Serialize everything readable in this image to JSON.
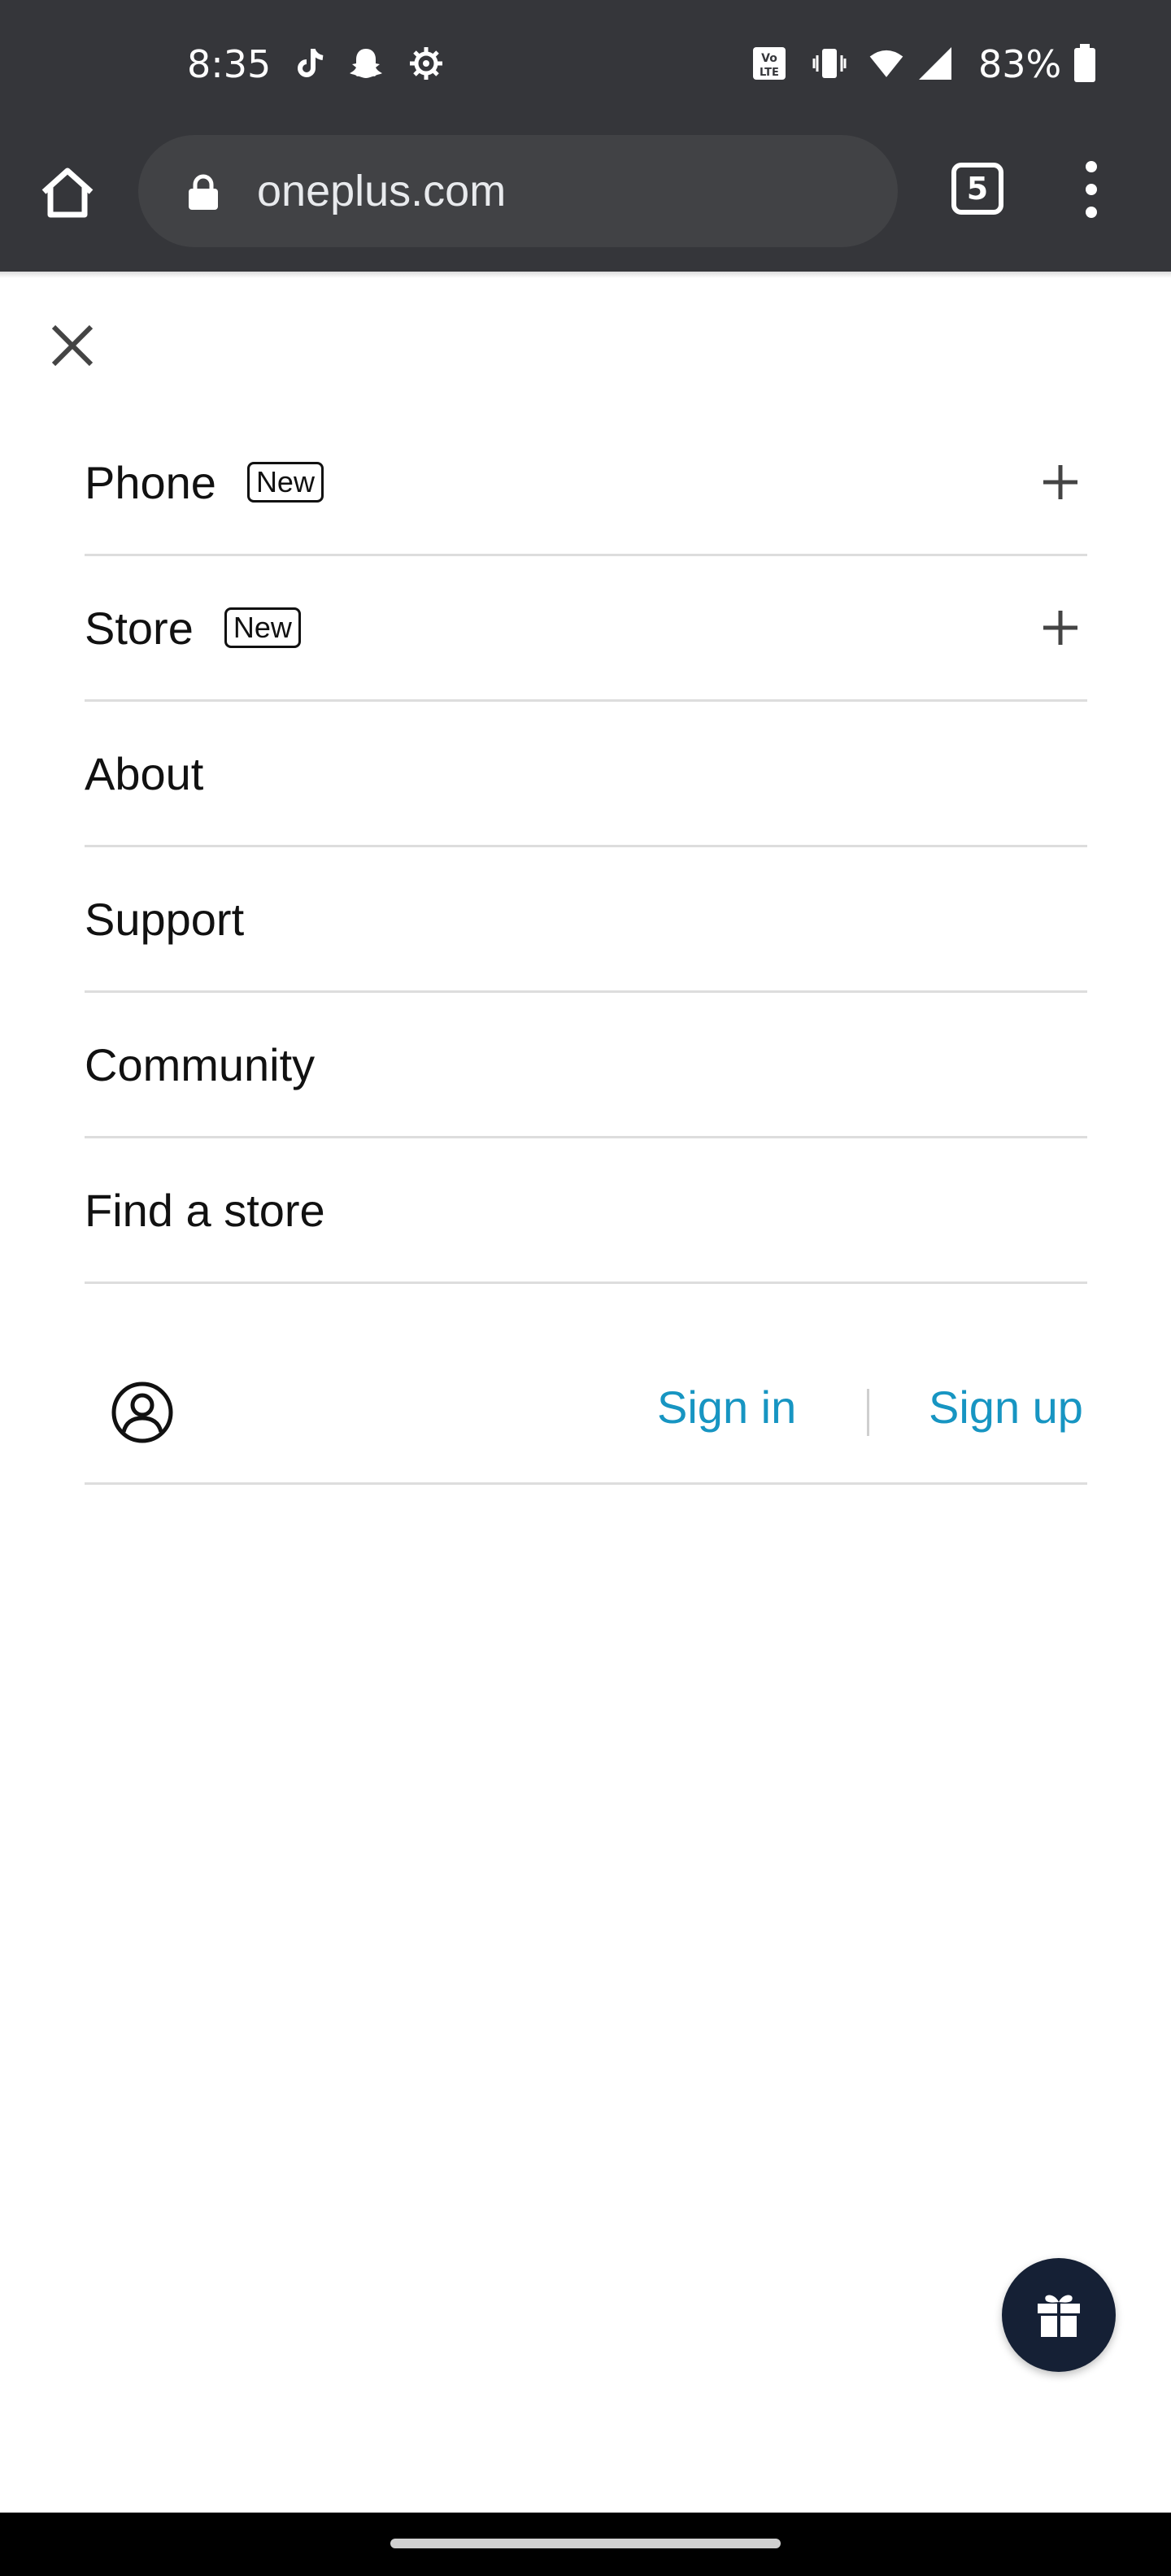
{
  "status_bar": {
    "time": "8:35",
    "battery": "83%",
    "icons": [
      "tiktok-icon",
      "snapchat-icon",
      "settings-gear-icon",
      "volte-icon",
      "vibrate-icon",
      "wifi-icon",
      "signal-icon",
      "battery-icon"
    ]
  },
  "browser": {
    "url": "oneplus.com",
    "tab_count": "5"
  },
  "menu": {
    "items": [
      {
        "label": "Phone",
        "badge": "New",
        "expandable": true
      },
      {
        "label": "Store",
        "badge": "New",
        "expandable": true
      },
      {
        "label": "About"
      },
      {
        "label": "Support"
      },
      {
        "label": "Community"
      },
      {
        "label": "Find a store"
      }
    ]
  },
  "account": {
    "sign_in": "Sign in",
    "sign_up": "Sign up"
  },
  "colors": {
    "accent": "#1795c2",
    "toolbar": "#35363a",
    "gift_button": "#152035"
  }
}
